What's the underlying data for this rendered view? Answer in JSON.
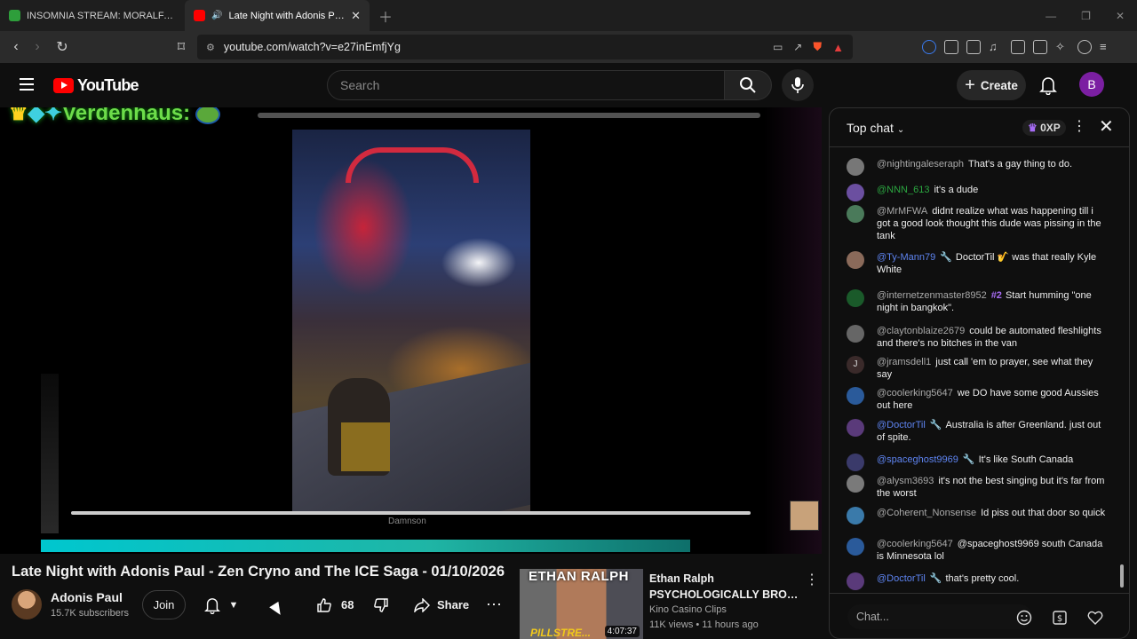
{
  "browser": {
    "tabs": [
      {
        "label": "INSOMNIA STREAM: MORALFAG ED",
        "active": false,
        "favicon_color": "#2e9e3b"
      },
      {
        "label": "Late Night with Adonis Paul -",
        "active": true,
        "favicon_color": "#ff0000"
      }
    ],
    "url": "youtube.com/watch?v=e27inEmfjYg"
  },
  "youtube": {
    "logo_text": "YouTube",
    "search_placeholder": "Search",
    "create_label": "Create",
    "avatar_letter": "B"
  },
  "player": {
    "overlay_username": "Verdenhaus:",
    "caption_text": "Damnson",
    "progress_fraction": 0.79
  },
  "video": {
    "title": "Late Night with Adonis Paul - Zen Cryno and The ICE Saga - 01/10/2026",
    "channel_name": "Adonis Paul",
    "subscribers": "15.7K subscribers",
    "join_label": "Join",
    "like_count": "68",
    "share_label": "Share"
  },
  "recommended": {
    "thumb_banner": "ETHAN RALPH",
    "thumb_ribbon": "PILLSTRE...",
    "duration": "4:07:37",
    "title_line1": "Ethan Ralph",
    "title_line2": "PSYCHOLOGICALLY BROKEN ...",
    "channel": "Kino Casino Clips",
    "meta": "11K views • 11 hours ago"
  },
  "chat": {
    "mode_label": "Top chat",
    "xp_label": "0XP",
    "input_placeholder": "Chat...",
    "messages": [
      {
        "author": "@nightingaleseraph",
        "text": "That's a gay thing to do.",
        "color": "gray",
        "avatar": "#777777"
      },
      {
        "author": "@NNN_613",
        "text": "it's a dude",
        "color": "green",
        "avatar": "#6b4fa0"
      },
      {
        "author": "@MrMFWA",
        "text": "didnt realize what was happening till i got a good look thought this dude was pissing in the tank",
        "color": "gray",
        "avatar": "#4a7a5a"
      },
      {
        "author": "@Ty-Mann79",
        "text": "DoctorTil 🎷 was that really Kyle White",
        "color": "blue",
        "avatar": "#8a6a5a"
      },
      {
        "author": "@internetzenmaster8952",
        "badge": "#2",
        "text": "Start humming \"one night in bangkok\".",
        "color": "gray",
        "avatar": "#1a5a2a"
      },
      {
        "author": "@claytonblaize2679",
        "text": "could be automated fleshlights and there's no bitches in the van",
        "color": "gray",
        "avatar": "#666666"
      },
      {
        "author": "@jramsdell1",
        "text": "just call 'em to prayer, see what they say",
        "color": "gray",
        "avatar": "#3a2a2a",
        "initial": "J"
      },
      {
        "author": "@coolerking5647",
        "text": "we DO have some good Aussies out here",
        "color": "gray",
        "avatar": "#2a5a9a"
      },
      {
        "author": "@DoctorTil",
        "text": "Australia is after Greenland. just out of spite.",
        "color": "blue",
        "avatar": "#5a3a7a"
      },
      {
        "author": "@spaceghost9969",
        "text": "It's like South Canada",
        "color": "blue",
        "avatar": "#3a3a6a"
      },
      {
        "author": "@alysm3693",
        "text": "it's not the best singing but it's far from the worst",
        "color": "gray",
        "avatar": "#7a7a7a"
      },
      {
        "author": "@Coherent_Nonsense",
        "text": "Id piss out that door so quick",
        "color": "gray",
        "avatar": "#3a7aaa"
      },
      {
        "author": "@coolerking5647",
        "text": "@spaceghost9969 south Canada is Minnesota lol",
        "color": "gray",
        "avatar": "#2a5a9a"
      },
      {
        "author": "@DoctorTil",
        "text": "that's pretty cool.",
        "color": "blue",
        "avatar": "#5a3a7a"
      }
    ]
  }
}
